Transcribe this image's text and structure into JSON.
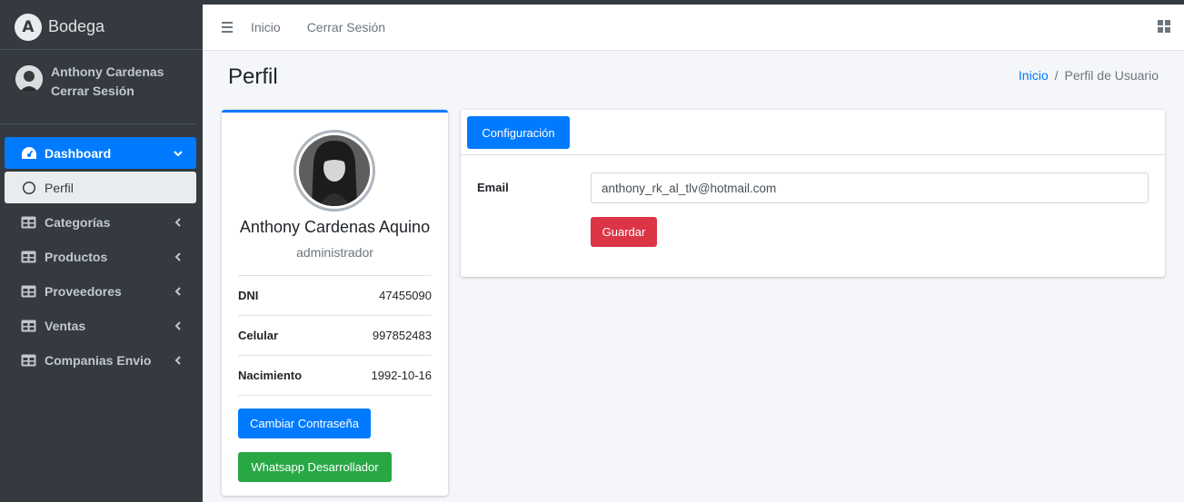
{
  "brand": {
    "name": "Bodega",
    "logo_letter": "A"
  },
  "user_panel": {
    "name": "Anthony Cardenas",
    "logout": "Cerrar Sesión"
  },
  "sidebar": {
    "items": [
      {
        "label": "Dashboard",
        "icon": "dashboard-icon",
        "active": true
      },
      {
        "label": "Perfil",
        "icon": "circle-icon",
        "sub": true
      },
      {
        "label": "Categorías",
        "icon": "table-icon"
      },
      {
        "label": "Productos",
        "icon": "table-icon"
      },
      {
        "label": "Proveedores",
        "icon": "table-icon"
      },
      {
        "label": "Ventas",
        "icon": "table-icon"
      },
      {
        "label": "Companias Envio",
        "icon": "table-icon"
      }
    ]
  },
  "header": {
    "home": "Inicio",
    "logout": "Cerrar Sesión"
  },
  "page": {
    "title": "Perfil"
  },
  "breadcrumb": {
    "home": "Inicio",
    "separator": "/",
    "current": "Perfil de Usuario"
  },
  "profile": {
    "name": "Anthony Cardenas Aquino",
    "role": "administrador",
    "fields": [
      {
        "label": "DNI",
        "value": "47455090"
      },
      {
        "label": "Celular",
        "value": "997852483"
      },
      {
        "label": "Nacimiento",
        "value": "1992-10-16"
      }
    ],
    "change_password": "Cambiar Contraseña",
    "whatsapp": "Whatsapp Desarrollador"
  },
  "settings": {
    "tab": "Configuración",
    "email_label": "Email",
    "email_value": "anthony_rk_al_tlv@hotmail.com",
    "save": "Guardar"
  },
  "colors": {
    "primary": "#007bff",
    "success": "#28a745",
    "danger": "#dc3545",
    "sidebar": "#343a40"
  }
}
